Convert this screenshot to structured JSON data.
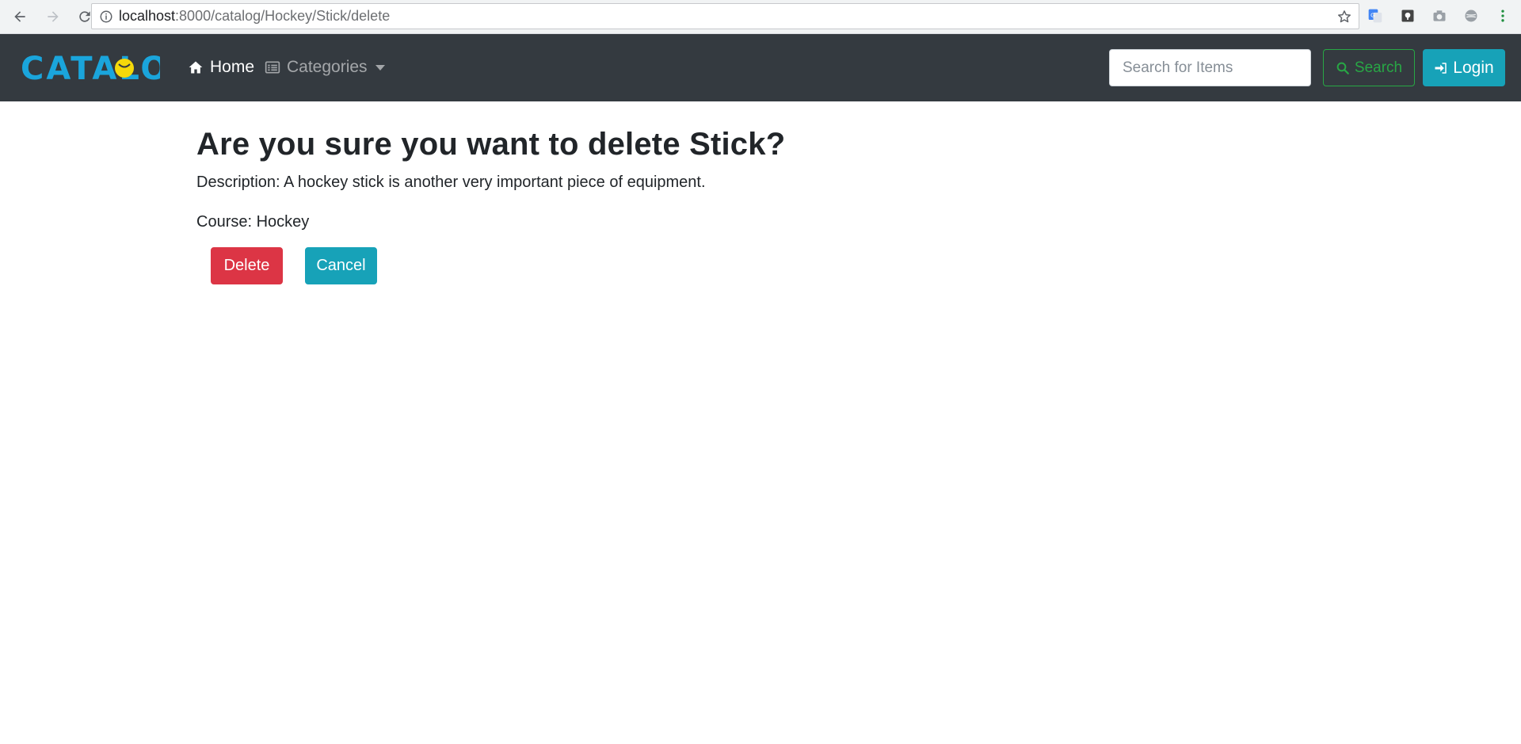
{
  "browser": {
    "url_host": "localhost",
    "url_path": ":8000/catalog/Hockey/Stick/delete"
  },
  "navbar": {
    "brand": "CATALOG",
    "home_label": "Home",
    "categories_label": "Categories",
    "search_placeholder": "Search for Items",
    "search_button": "Search",
    "login_button": "Login"
  },
  "main": {
    "title": "Are you sure you want to delete Stick?",
    "description": "Description: A hockey stick is another very important piece of equipment.",
    "course": "Course: Hockey",
    "delete_button": "Delete",
    "cancel_button": "Cancel"
  },
  "colors": {
    "navbar_bg": "#343a40",
    "brand": "#1aa5dc",
    "danger": "#dc3545",
    "info": "#17a2b8",
    "success": "#28a745"
  }
}
